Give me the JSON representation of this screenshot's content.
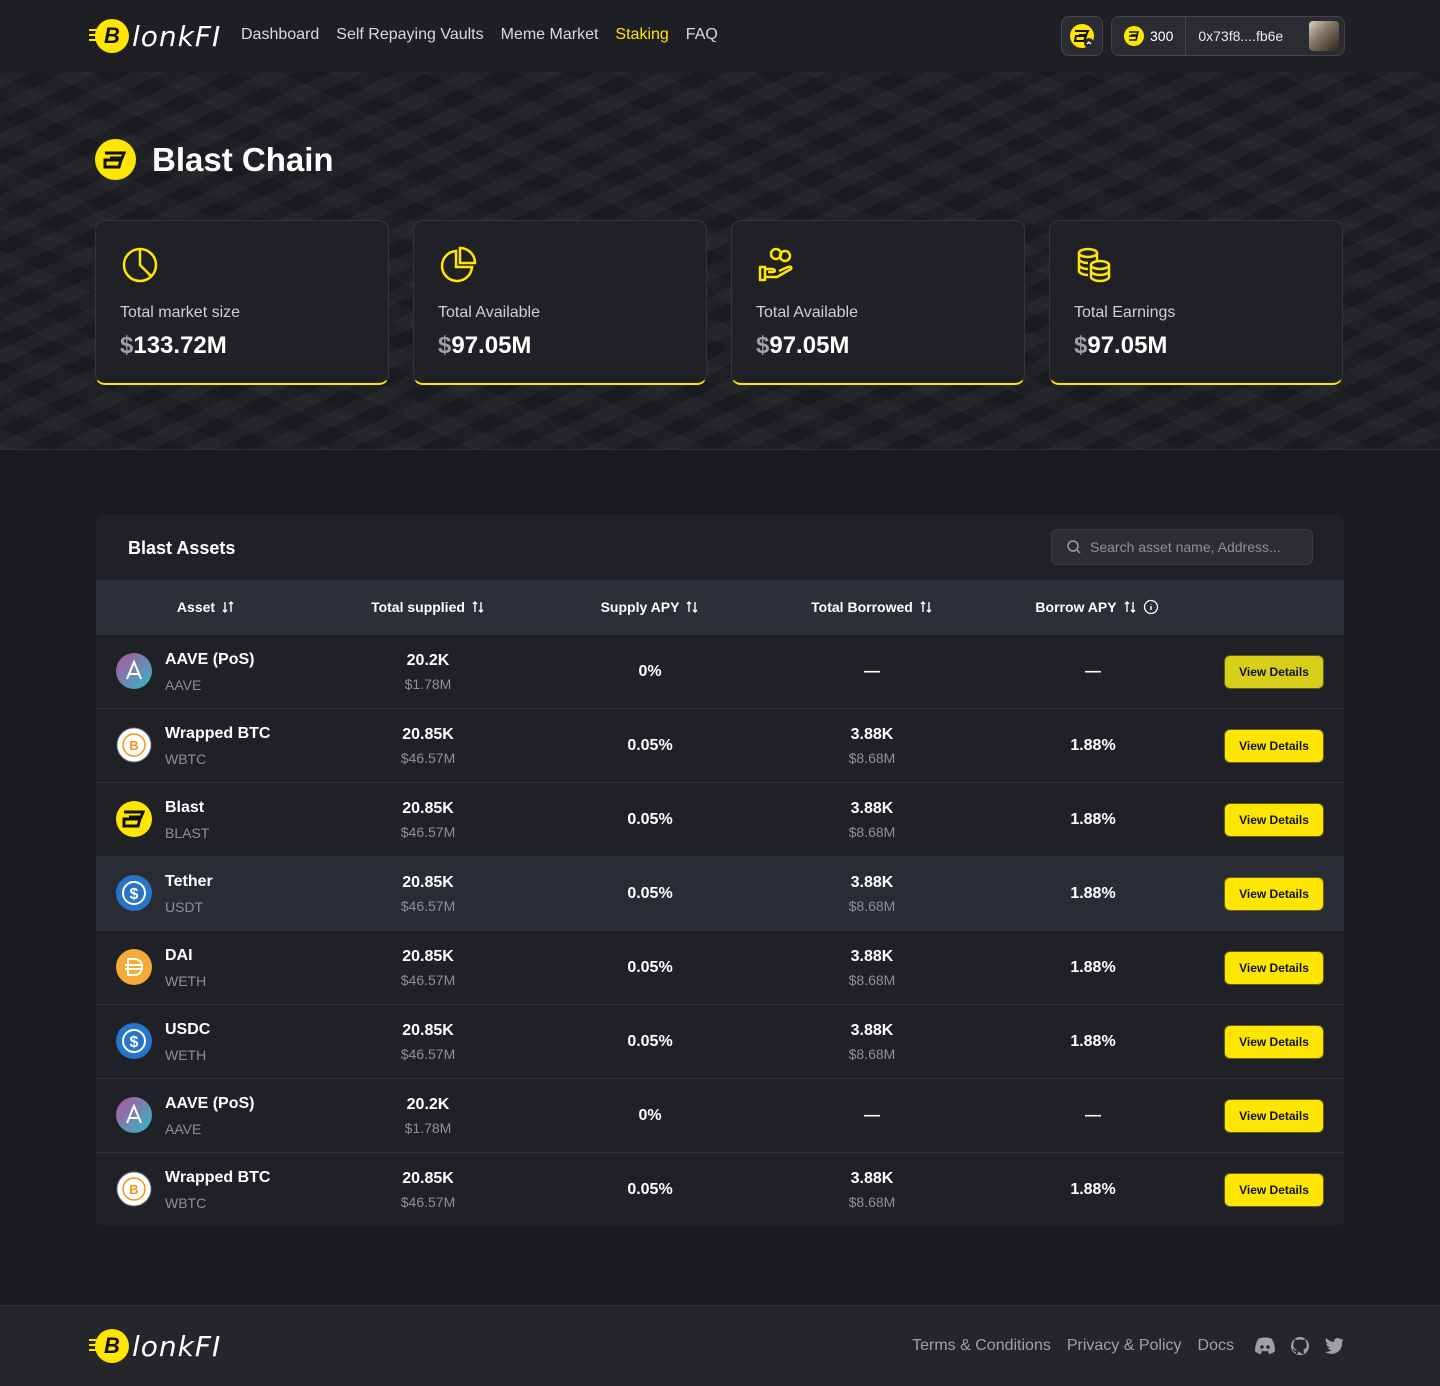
{
  "header": {
    "logo_text": "lonkFI",
    "logo_letter": "B",
    "nav": [
      {
        "label": "Dashboard",
        "active": false
      },
      {
        "label": "Self Repaying Vaults",
        "active": false
      },
      {
        "label": "Meme Market",
        "active": false
      },
      {
        "label": "Staking",
        "active": true
      },
      {
        "label": "FAQ",
        "active": false
      }
    ],
    "balance": "300",
    "address": "0x73f8....fb6e"
  },
  "hero": {
    "title": "Blast Chain",
    "stats": [
      {
        "icon": "pie-chart-icon",
        "label": "Total market size",
        "currency": "$",
        "value": "133.72M"
      },
      {
        "icon": "pie-chart-slice-icon",
        "label": "Total Available",
        "currency": "$",
        "value": "97.05M"
      },
      {
        "icon": "hand-coins-icon",
        "label": "Total Available",
        "currency": "$",
        "value": "97.05M"
      },
      {
        "icon": "coin-stack-icon",
        "label": "Total Earnings",
        "currency": "$",
        "value": "97.05M"
      }
    ]
  },
  "assets": {
    "title": "Blast Assets",
    "search_placeholder": "Search asset name, Address...",
    "columns": {
      "asset": "Asset",
      "total_supplied": "Total supplied",
      "supply_apy": "Supply APY",
      "total_borrowed": "Total Borrowed",
      "borrow_apy": "Borrow APY"
    },
    "button_label": "View Details",
    "rows": [
      {
        "icon": "aave-icon",
        "name": "AAVE (PoS)",
        "symbol": "AAVE",
        "supplied": "20.2K",
        "supplied_usd": "$1.78M",
        "supply_apy": "0%",
        "borrowed": "—",
        "borrowed_usd": "",
        "borrow_apy": "—"
      },
      {
        "icon": "bitcoin-icon",
        "name": "Wrapped BTC",
        "symbol": "WBTC",
        "supplied": "20.85K",
        "supplied_usd": "$46.57M",
        "supply_apy": "0.05%",
        "borrowed": "3.88K",
        "borrowed_usd": "$8.68M",
        "borrow_apy": "1.88%"
      },
      {
        "icon": "blast-icon",
        "name": "Blast",
        "symbol": "BLAST",
        "supplied": "20.85K",
        "supplied_usd": "$46.57M",
        "supply_apy": "0.05%",
        "borrowed": "3.88K",
        "borrowed_usd": "$8.68M",
        "borrow_apy": "1.88%"
      },
      {
        "icon": "tether-icon",
        "name": "Tether",
        "symbol": "USDT",
        "supplied": "20.85K",
        "supplied_usd": "$46.57M",
        "supply_apy": "0.05%",
        "borrowed": "3.88K",
        "borrowed_usd": "$8.68M",
        "borrow_apy": "1.88%"
      },
      {
        "icon": "dai-icon",
        "name": "DAI",
        "symbol": "WETH",
        "supplied": "20.85K",
        "supplied_usd": "$46.57M",
        "supply_apy": "0.05%",
        "borrowed": "3.88K",
        "borrowed_usd": "$8.68M",
        "borrow_apy": "1.88%"
      },
      {
        "icon": "usdc-icon",
        "name": "USDC",
        "symbol": "WETH",
        "supplied": "20.85K",
        "supplied_usd": "$46.57M",
        "supply_apy": "0.05%",
        "borrowed": "3.88K",
        "borrowed_usd": "$8.68M",
        "borrow_apy": "1.88%"
      },
      {
        "icon": "aave-icon",
        "name": "AAVE (PoS)",
        "symbol": "AAVE",
        "supplied": "20.2K",
        "supplied_usd": "$1.78M",
        "supply_apy": "0%",
        "borrowed": "—",
        "borrowed_usd": "",
        "borrow_apy": "—"
      },
      {
        "icon": "bitcoin-icon",
        "name": "Wrapped BTC",
        "symbol": "WBTC",
        "supplied": "20.85K",
        "supplied_usd": "$46.57M",
        "supply_apy": "0.05%",
        "borrowed": "3.88K",
        "borrowed_usd": "$8.68M",
        "borrow_apy": "1.88%"
      }
    ]
  },
  "footer": {
    "logo_text": "lonkFI",
    "links": [
      "Terms & Conditions",
      "Privacy & Policy",
      "Docs"
    ],
    "social": [
      "discord-icon",
      "github-icon",
      "twitter-icon"
    ]
  },
  "colors": {
    "accent": "#ffe600",
    "background": "#1a1b1f",
    "card": "#202127"
  }
}
